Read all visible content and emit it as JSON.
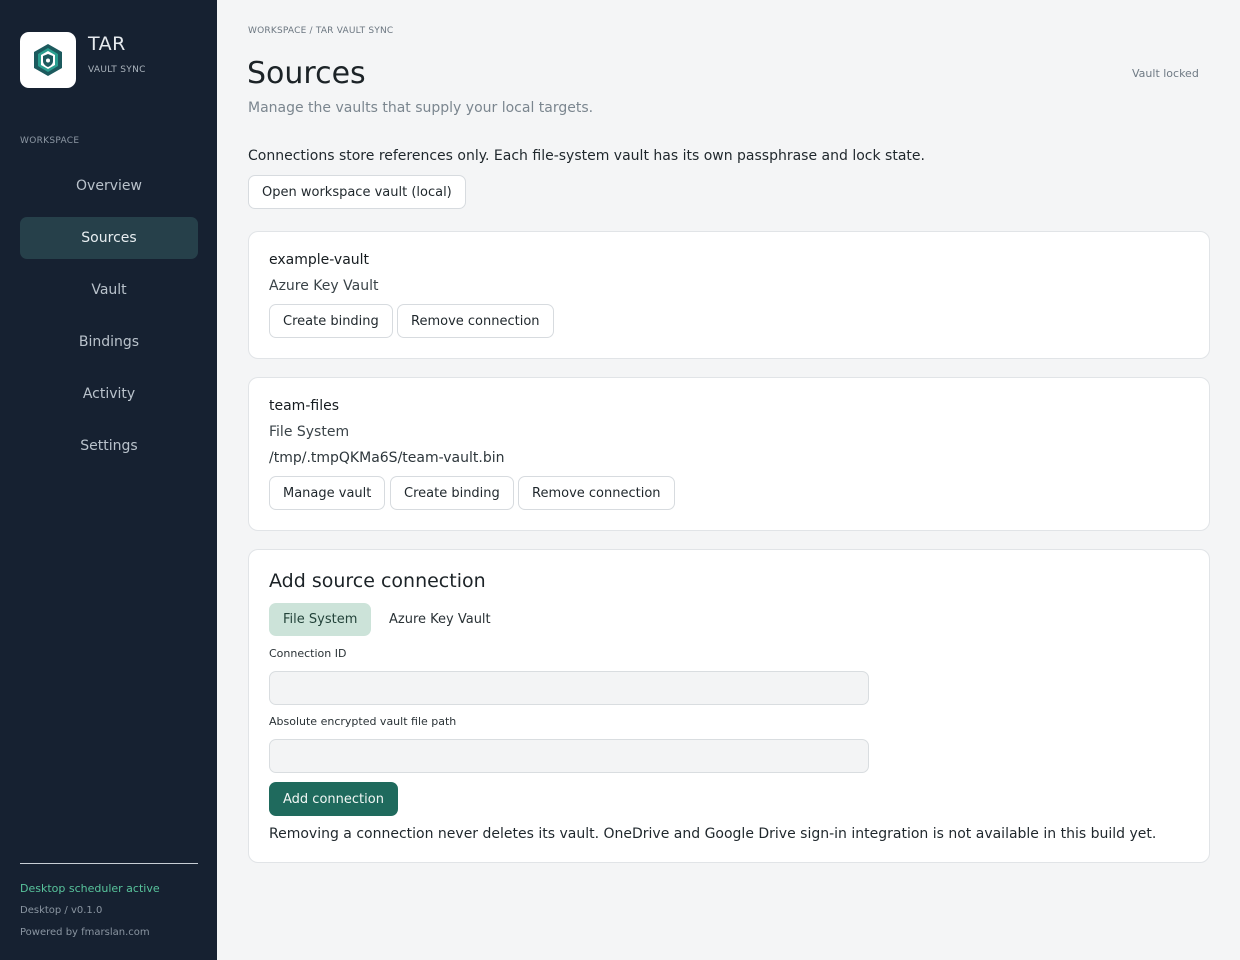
{
  "brand": {
    "name": "TAR",
    "subtitle": "VAULT SYNC",
    "logo_icon": "shield-logo-icon"
  },
  "sidebar": {
    "section_label": "WORKSPACE",
    "items": [
      {
        "label": "Overview",
        "active": false
      },
      {
        "label": "Sources",
        "active": true
      },
      {
        "label": "Vault",
        "active": false
      },
      {
        "label": "Bindings",
        "active": false
      },
      {
        "label": "Activity",
        "active": false
      },
      {
        "label": "Settings",
        "active": false
      }
    ],
    "scheduler_status": "Desktop scheduler active",
    "version": "Desktop / v0.1.0",
    "powered_by": "Powered by fmarslan.com"
  },
  "header": {
    "breadcrumb": "WORKSPACE / TAR VAULT SYNC",
    "title": "Sources",
    "subtitle": "Manage the vaults that supply your local targets.",
    "lock_status": "Vault locked"
  },
  "info_text": "Connections store references only. Each file-system vault has its own passphrase and lock state.",
  "open_workspace_button": "Open workspace vault (local)",
  "connections": [
    {
      "id": "example-vault",
      "type": "Azure Key Vault",
      "buttons": {
        "create_binding": "Create binding",
        "remove": "Remove connection"
      }
    },
    {
      "id": "team-files",
      "type": "File System",
      "path": "/tmp/.tmpQKMa6S/team-vault.bin",
      "buttons": {
        "manage": "Manage vault",
        "create_binding": "Create binding",
        "remove": "Remove connection"
      }
    }
  ],
  "add_connection": {
    "title": "Add source connection",
    "tabs": [
      {
        "label": "File System",
        "active": true
      },
      {
        "label": "Azure Key Vault",
        "active": false
      }
    ],
    "connection_id_label": "Connection ID",
    "connection_id_value": "",
    "path_label": "Absolute encrypted vault file path",
    "path_value": "",
    "submit_label": "Add connection",
    "note": "Removing a connection never deletes its vault. OneDrive and Google Drive sign-in integration is not available in this build yet."
  },
  "colors": {
    "sidebar_bg": "#162131",
    "accent": "#1f6a5d",
    "active_nav": "#26404a",
    "status_green": "#58c49c"
  }
}
